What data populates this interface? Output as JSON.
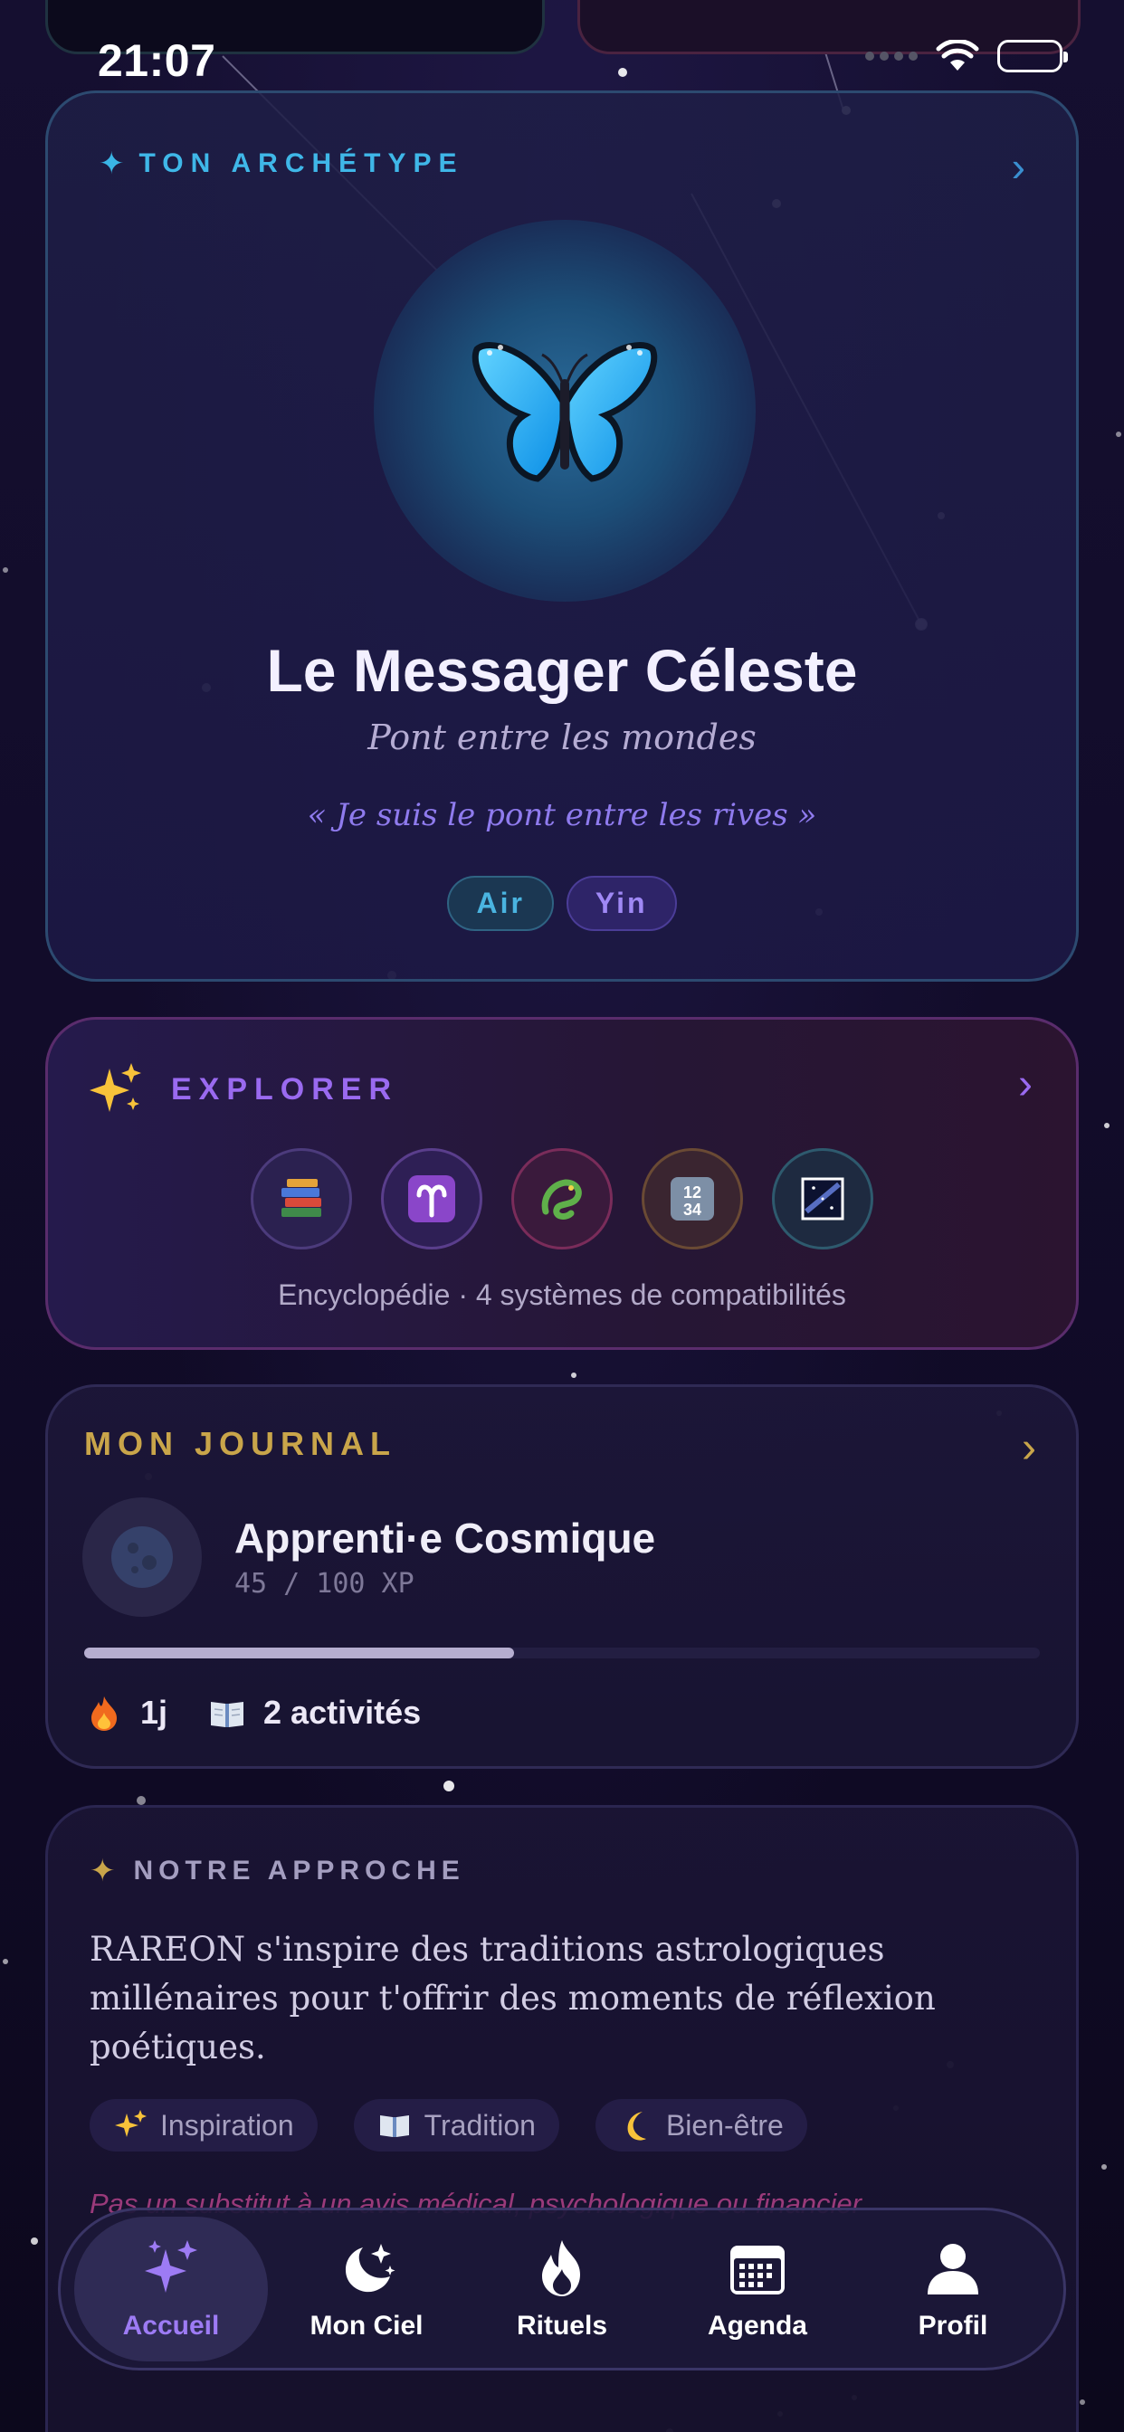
{
  "status_bar": {
    "time": "21:07"
  },
  "archetype": {
    "header": "TON ARCHÉTYPE",
    "name": "Le Messager Céleste",
    "subtitle": "Pont entre les mondes",
    "quote": "« Je suis le pont entre les rives »",
    "tags": [
      "Air",
      "Yin"
    ],
    "icon": "blue-butterfly"
  },
  "explorer": {
    "header": "EXPLORER",
    "icons": [
      "books-icon",
      "aries-icon",
      "dragon-icon",
      "numbers-icon",
      "milky-way-icon"
    ],
    "caption": "Encyclopédie · 4 systèmes de compatibilités"
  },
  "journal": {
    "header": "MON JOURNAL",
    "level_title": "Apprenti·e Cosmique",
    "xp_text": "45 / 100 XP",
    "xp_progress": 0.45,
    "streak": "1j",
    "activities": "2 activités"
  },
  "approach": {
    "header": "NOTRE APPROCHE",
    "text": "RAREON s'inspire des traditions astrologiques millénaires pour t'offrir des moments de réflexion poétiques.",
    "pills": [
      "Inspiration",
      "Tradition",
      "Bien-être"
    ],
    "disclaimer": "Pas un substitut à un avis médical, psychologique ou financier"
  },
  "nav": {
    "items": [
      {
        "label": "Accueil",
        "icon": "sparkles-icon",
        "active": true
      },
      {
        "label": "Mon Ciel",
        "icon": "moon-stars-icon",
        "active": false
      },
      {
        "label": "Rituels",
        "icon": "flame-icon",
        "active": false
      },
      {
        "label": "Agenda",
        "icon": "calendar-icon",
        "active": false
      },
      {
        "label": "Profil",
        "icon": "person-icon",
        "active": false
      }
    ]
  },
  "colors": {
    "background": "#120c2a",
    "accent_purple": "#9d7bf4",
    "accent_cyan": "#3fb7e8",
    "accent_gold": "#c9a54a",
    "disclaimer_pink": "#9a3a7a"
  }
}
